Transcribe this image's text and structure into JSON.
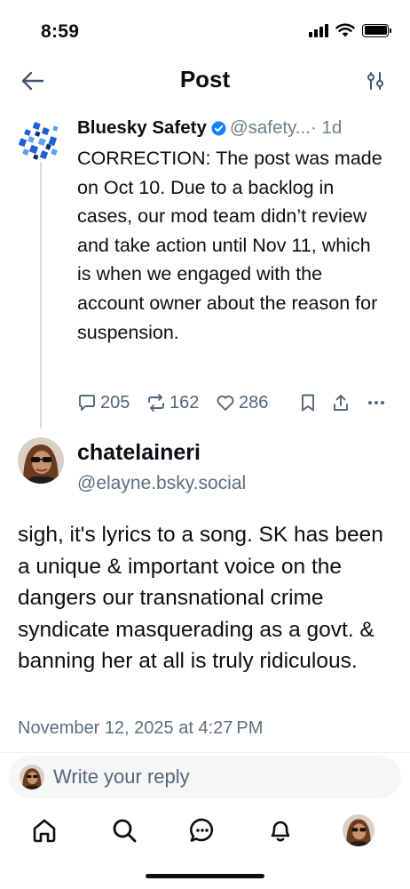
{
  "status_bar": {
    "time": "8:59"
  },
  "header": {
    "title": "Post"
  },
  "parent_post": {
    "author_name": "Bluesky Safety",
    "author_handle": "@safety...",
    "age": " · 1d",
    "text": "CORRECTION: The post was made on Oct 10. Due to a backlog in cases, our mod team didn’t review and take action until Nov 11, which is when we engaged with the account owner about the reason for suspension.",
    "reply_count": "205",
    "repost_count": "162",
    "like_count": "286"
  },
  "main_post": {
    "author_name": "chatelaineri",
    "author_handle": "@elayne.bsky.social",
    "text": "sigh, it's lyrics to a song. SK has been a unique & important voice on the dangers our transnational crime syndicate masquerading as a govt. & banning her at all is truly ridiculous.",
    "timestamp": "November 12, 2025 at 4:27 PM"
  },
  "reply_box": {
    "placeholder": "Write your reply"
  },
  "tabs": [
    "home-icon",
    "search-icon",
    "chat-icon",
    "bell-icon",
    "profile-avatar"
  ],
  "colors": {
    "accent": "#1083fe",
    "muted": "#53667a",
    "text": "#0b0f14"
  }
}
